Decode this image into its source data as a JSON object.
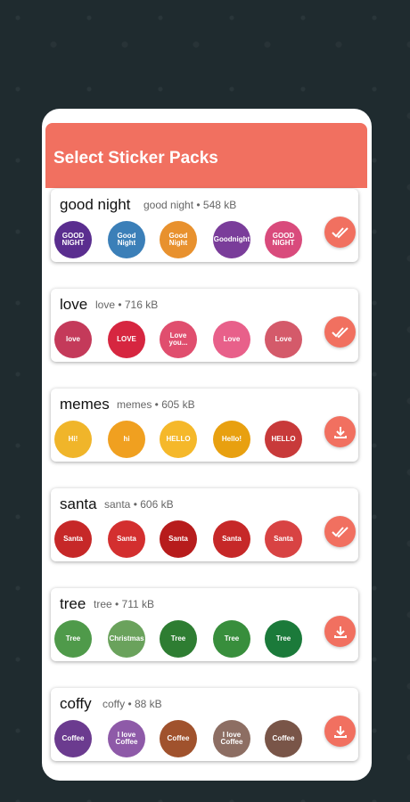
{
  "app_bar": {
    "title": "Select Sticker Packs"
  },
  "colors": {
    "accent": "#f17060",
    "background": "#1f2b2f"
  },
  "packs": [
    {
      "name": "good night",
      "meta": "good night • 548 kB",
      "status": "added",
      "stickers": [
        {
          "label": "GOOD NIGHT",
          "color": "#5a2e8f"
        },
        {
          "label": "Good Night",
          "color": "#3b7fb8"
        },
        {
          "label": "Good Night",
          "color": "#e8912e"
        },
        {
          "label": "Goodnight",
          "color": "#7a3d9a"
        },
        {
          "label": "GOOD NIGHT",
          "color": "#d94b7c"
        }
      ]
    },
    {
      "name": "love",
      "meta": "love • 716 kB",
      "status": "added",
      "stickers": [
        {
          "label": "love",
          "color": "#c43a5a"
        },
        {
          "label": "LOVE",
          "color": "#d62640"
        },
        {
          "label": "Love you...",
          "color": "#e04e6e"
        },
        {
          "label": "Love",
          "color": "#e8608a"
        },
        {
          "label": "Love",
          "color": "#d45a6a"
        }
      ]
    },
    {
      "name": "memes",
      "meta": "memes • 605 kB",
      "status": "download",
      "stickers": [
        {
          "label": "Hi!",
          "color": "#f0b52a"
        },
        {
          "label": "hi",
          "color": "#f0a020"
        },
        {
          "label": "HELLO",
          "color": "#f5b82a"
        },
        {
          "label": "Hello!",
          "color": "#e8a010"
        },
        {
          "label": "HELLO",
          "color": "#c83a3a"
        }
      ]
    },
    {
      "name": "santa",
      "meta": "santa • 606 kB",
      "status": "added",
      "stickers": [
        {
          "label": "Santa",
          "color": "#c62828"
        },
        {
          "label": "Santa",
          "color": "#d32f2f"
        },
        {
          "label": "Santa",
          "color": "#b71c1c"
        },
        {
          "label": "Santa",
          "color": "#c62828"
        },
        {
          "label": "Santa",
          "color": "#d84343"
        }
      ]
    },
    {
      "name": "tree",
      "meta": "tree • 711 kB",
      "status": "download",
      "stickers": [
        {
          "label": "Tree",
          "color": "#4f9a4a"
        },
        {
          "label": "Christmas",
          "color": "#6aa25c"
        },
        {
          "label": "Tree",
          "color": "#2e7d32"
        },
        {
          "label": "Tree",
          "color": "#388e3c"
        },
        {
          "label": "Tree",
          "color": "#1b7a3a"
        }
      ]
    },
    {
      "name": "coffy",
      "meta": "coffy • 88 kB",
      "status": "download",
      "stickers": [
        {
          "label": "Coffee",
          "color": "#6b3b8f"
        },
        {
          "label": "I love Coffee",
          "color": "#8e5aa8"
        },
        {
          "label": "Coffee",
          "color": "#a0522d"
        },
        {
          "label": "I love Coffee",
          "color": "#8d6e63"
        },
        {
          "label": "Coffee",
          "color": "#795548"
        }
      ]
    }
  ]
}
